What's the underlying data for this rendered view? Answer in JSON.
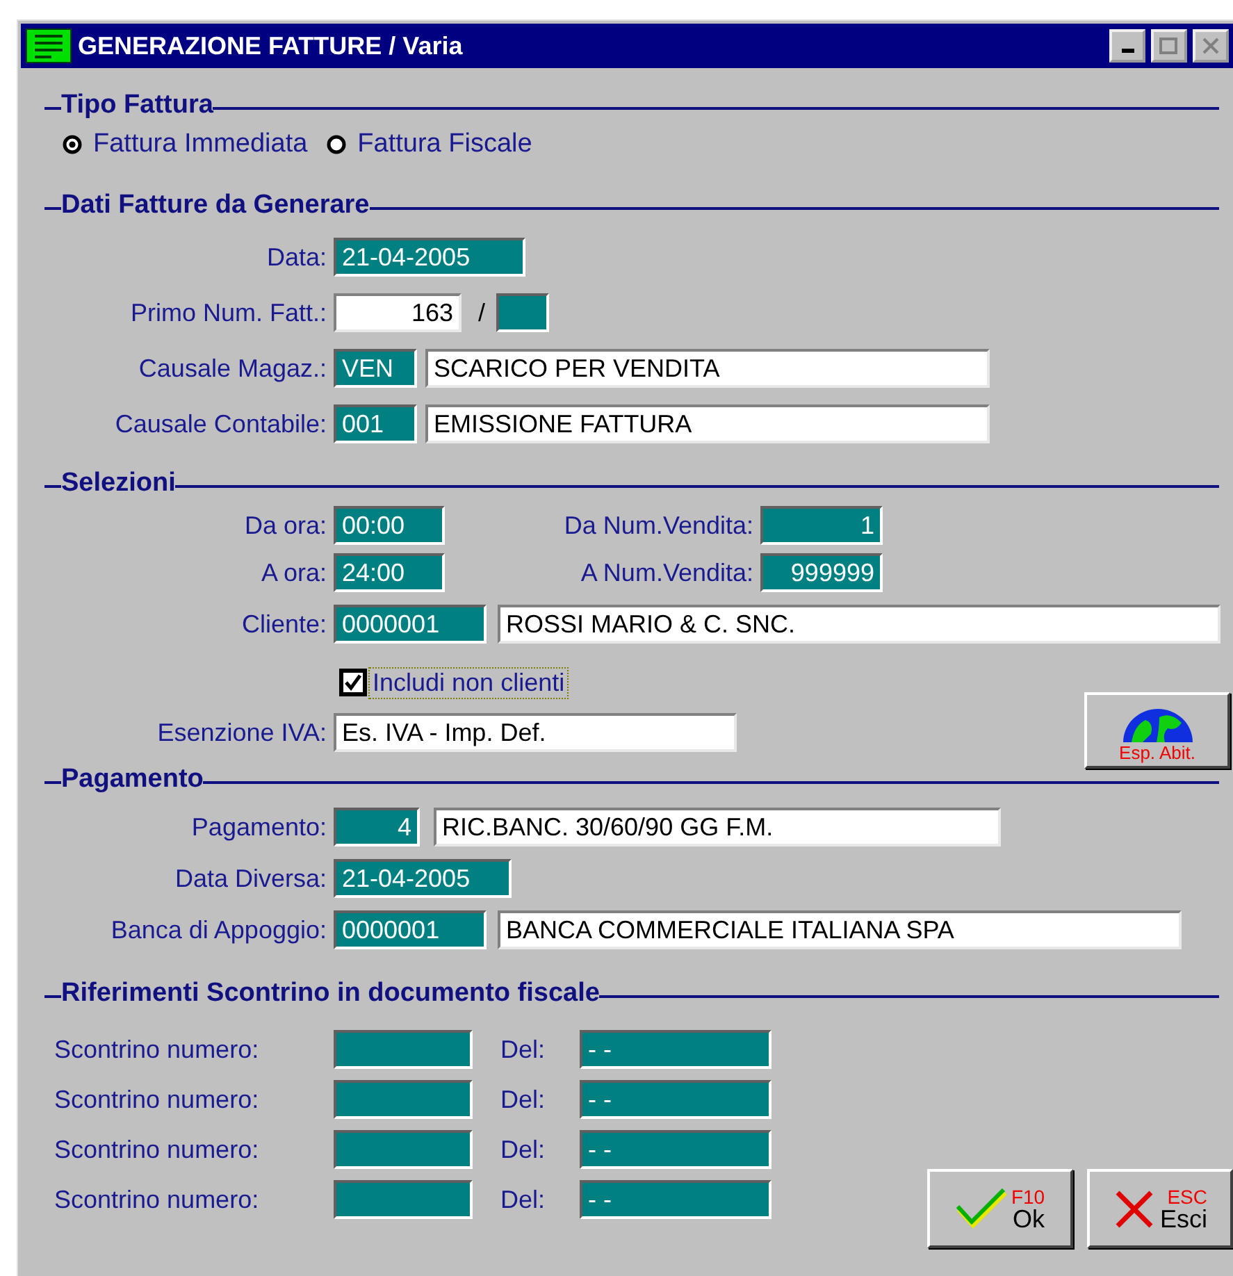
{
  "window": {
    "title": "GENERAZIONE FATTURE / Varia"
  },
  "tipo_fattura": {
    "heading": "Tipo Fattura",
    "options": [
      {
        "label": "Fattura Immediata",
        "selected": true
      },
      {
        "label": "Fattura Fiscale",
        "selected": false
      }
    ]
  },
  "dati_fatture": {
    "heading": "Dati Fatture da Generare",
    "data": {
      "label": "Data:",
      "value": "21-04-2005"
    },
    "primo_num": {
      "label": "Primo Num. Fatt.:",
      "value": "163",
      "separator": "/"
    },
    "causale_magaz": {
      "label": "Causale Magaz.:",
      "code": "VEN",
      "description": "SCARICO PER VENDITA"
    },
    "causale_contabile": {
      "label": "Causale Contabile:",
      "code": "001",
      "description": "EMISSIONE FATTURA"
    }
  },
  "selezioni": {
    "heading": "Selezioni",
    "da_ora": {
      "label": "Da ora:",
      "value": "00:00"
    },
    "da_num_vendita": {
      "label": "Da Num.Vendita:",
      "value": "1"
    },
    "a_ora": {
      "label": "A ora:",
      "value": "24:00"
    },
    "a_num_vendita": {
      "label": "A Num.Vendita:",
      "value": "999999"
    },
    "cliente": {
      "label": "Cliente:",
      "code": "0000001",
      "description": "ROSSI MARIO & C. SNC."
    },
    "includi_non_clienti": {
      "label": "Includi non clienti",
      "checked": true,
      "focused": true
    },
    "esenzione_iva": {
      "label": "Esenzione IVA:",
      "value": "Es. IVA - Imp. Def."
    },
    "esp_abit_button": {
      "label": "Esp. Abit."
    }
  },
  "pagamento": {
    "heading": "Pagamento",
    "pagamento": {
      "label": "Pagamento:",
      "code": "4",
      "description": "RIC.BANC. 30/60/90 GG F.M."
    },
    "data_diversa": {
      "label": "Data Diversa:",
      "value": "21-04-2005"
    },
    "banca": {
      "label": "Banca di Appoggio:",
      "code": "0000001",
      "description": "BANCA COMMERCIALE ITALIANA SPA"
    }
  },
  "riferimenti": {
    "heading": "Riferimenti Scontrino in documento fiscale",
    "rows": [
      {
        "label": "Scontrino numero:",
        "del_label": "Del:",
        "date": "- -"
      },
      {
        "label": "Scontrino numero:",
        "del_label": "Del:",
        "date": "- -"
      },
      {
        "label": "Scontrino numero:",
        "del_label": "Del:",
        "date": "- -"
      },
      {
        "label": "Scontrino numero:",
        "del_label": "Del:",
        "date": "- -"
      }
    ]
  },
  "buttons": [
    {
      "kind": "ok",
      "label": "Ok",
      "shortcut": "F10"
    },
    {
      "kind": "cancel",
      "label": "Esci",
      "shortcut": "ESC"
    }
  ]
}
